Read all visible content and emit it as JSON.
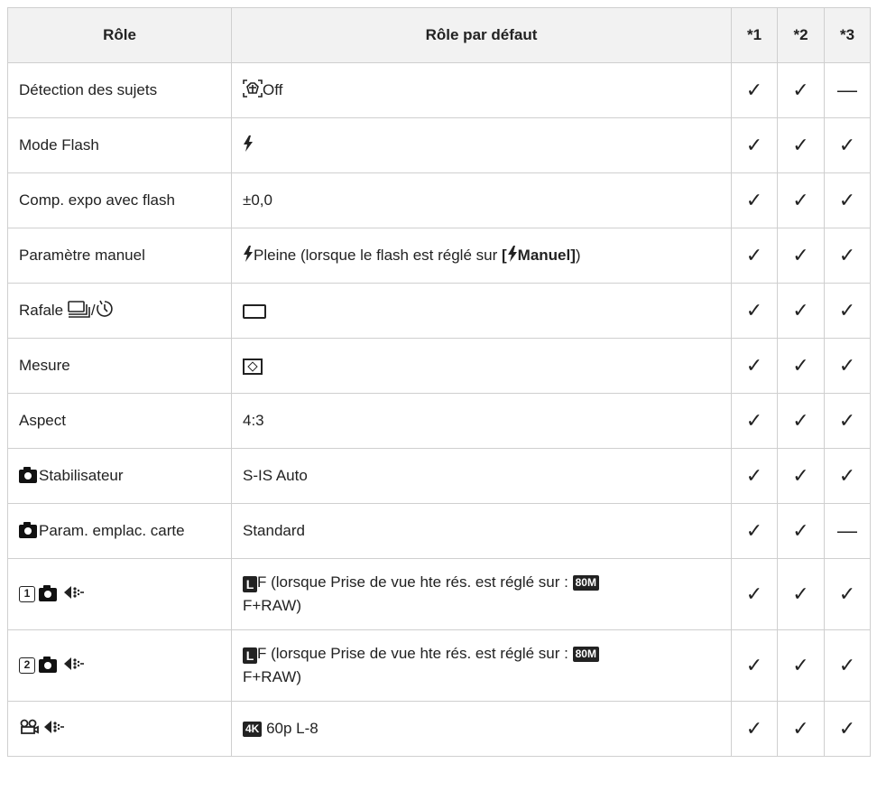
{
  "header": {
    "col_role": "Rôle",
    "col_default": "Rôle par défaut",
    "col1": "*1",
    "col2": "*2",
    "col3": "*3"
  },
  "symbols": {
    "check": "✓",
    "dash": "—"
  },
  "rows": [
    {
      "role": "Détection des sujets",
      "default": "Off",
      "c1": "✓",
      "c2": "✓",
      "c3": "—"
    },
    {
      "role": "Mode Flash",
      "default": "",
      "c1": "✓",
      "c2": "✓",
      "c3": "✓"
    },
    {
      "role": "Comp. expo avec flash",
      "default": "±0,0",
      "c1": "✓",
      "c2": "✓",
      "c3": "✓"
    },
    {
      "role": "Paramètre manuel",
      "default_pre": "Pleine (lorsque le flash est réglé sur ",
      "default_open": "[",
      "default_em": "Manuel",
      "default_close": "]",
      "default_post": ")",
      "c1": "✓",
      "c2": "✓",
      "c3": "✓"
    },
    {
      "role": "Rafale",
      "role_slash": "/",
      "default": "",
      "c1": "✓",
      "c2": "✓",
      "c3": "✓"
    },
    {
      "role": "Mesure",
      "default": "",
      "c1": "✓",
      "c2": "✓",
      "c3": "✓"
    },
    {
      "role": "Aspect",
      "default": "4:3",
      "c1": "✓",
      "c2": "✓",
      "c3": "✓"
    },
    {
      "role": "Stabilisateur",
      "default": "S-IS Auto",
      "c1": "✓",
      "c2": "✓",
      "c3": "✓"
    },
    {
      "role": "Param. emplac. carte",
      "default": "Standard",
      "c1": "✓",
      "c2": "✓",
      "c3": "—"
    },
    {
      "role_num": "1",
      "default_l": "L",
      "default_a": "F (lorsque Prise de vue hte rés. est réglé sur : ",
      "default_badge": "80M",
      "default_b": "F+RAW)",
      "c1": "✓",
      "c2": "✓",
      "c3": "✓"
    },
    {
      "role_num": "2",
      "default_l": "L",
      "default_a": "F (lorsque Prise de vue hte rés. est réglé sur : ",
      "default_badge": "80M",
      "default_b": "F+RAW)",
      "c1": "✓",
      "c2": "✓",
      "c3": "✓"
    },
    {
      "role_icon": "movie-icon",
      "default_badge": "4K",
      "default": "60p L-8",
      "c1": "✓",
      "c2": "✓",
      "c3": "✓"
    }
  ]
}
